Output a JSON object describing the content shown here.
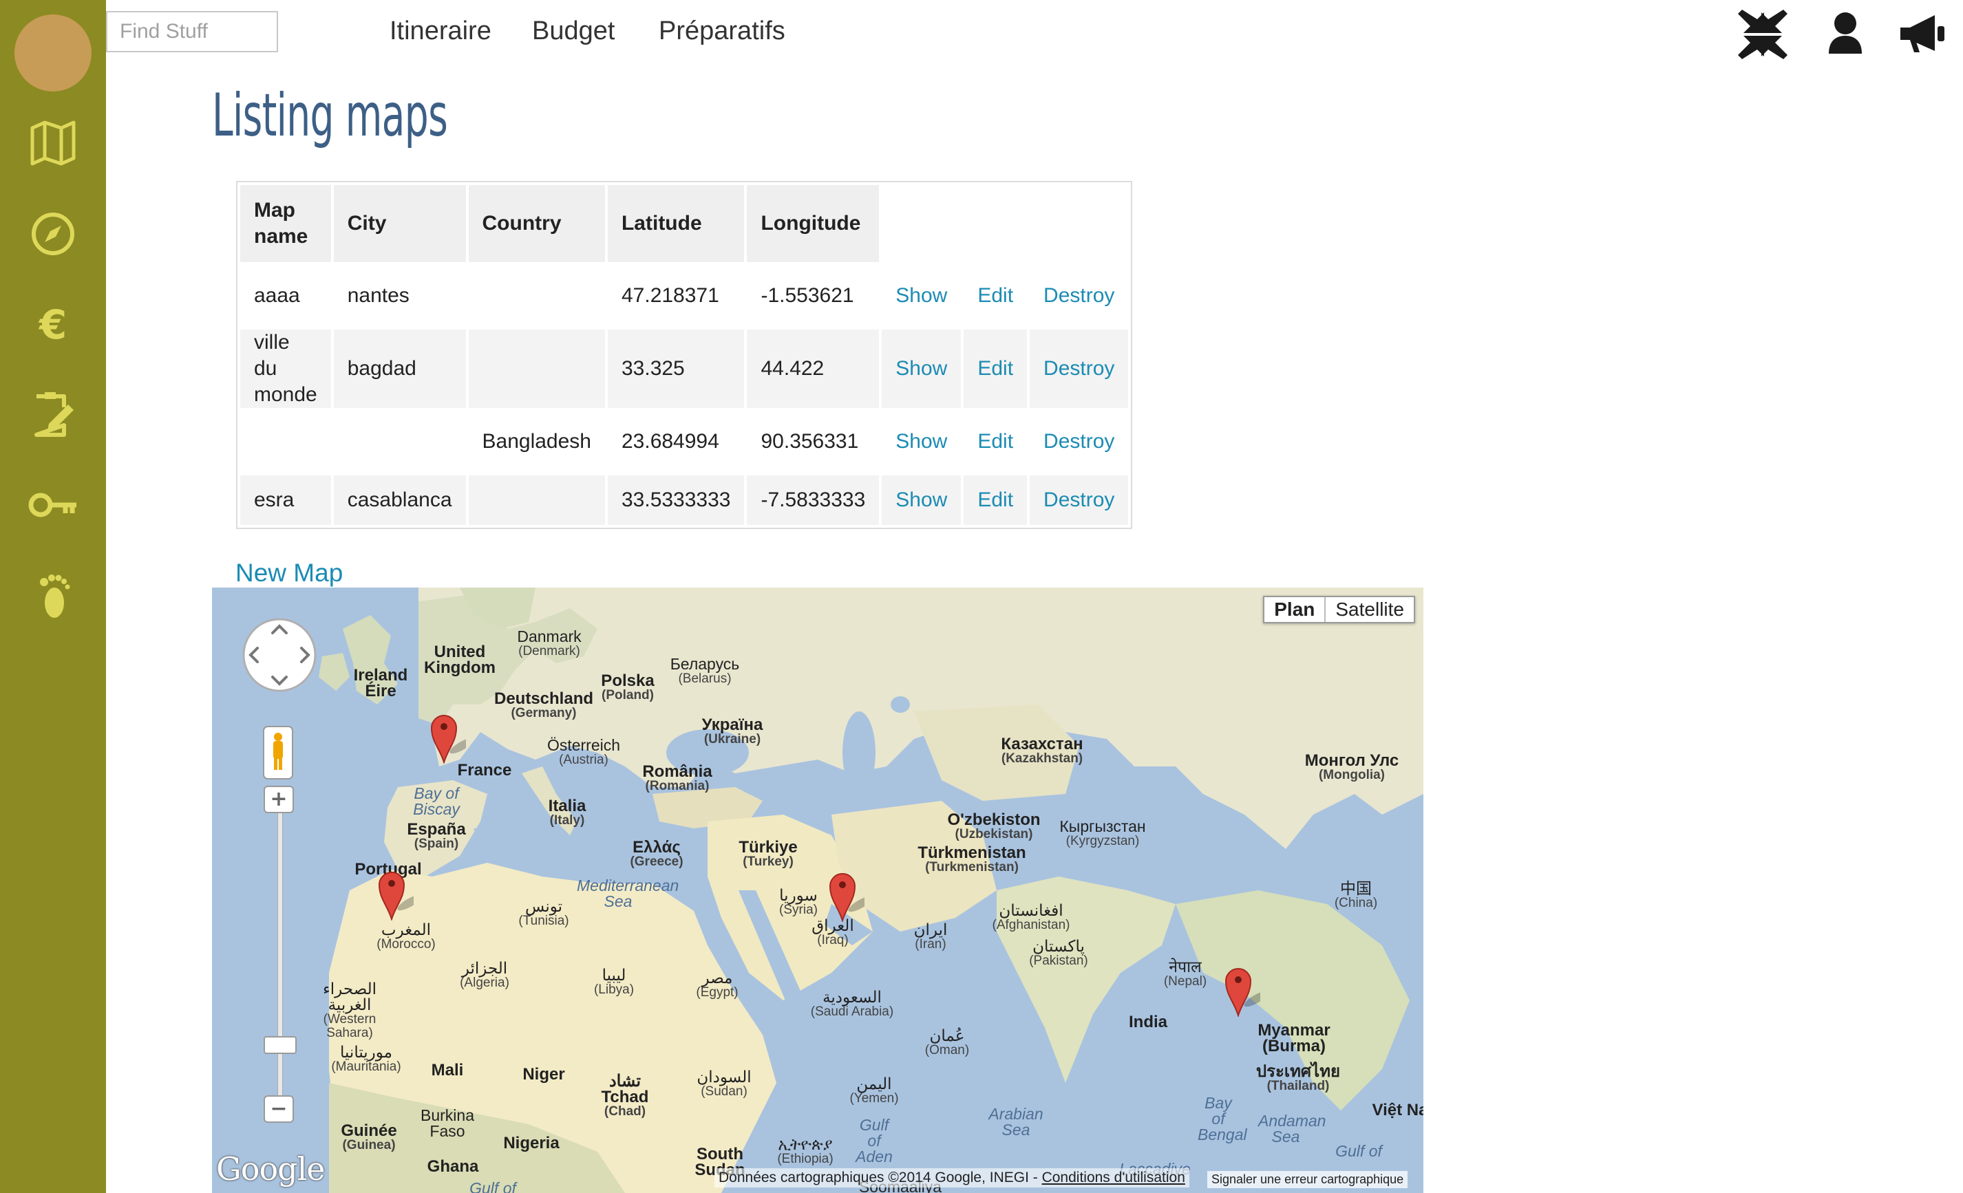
{
  "search": {
    "placeholder": "Find Stuff"
  },
  "nav": {
    "items": [
      "Itineraire",
      "Budget",
      "Préparatifs"
    ]
  },
  "sidebar": {
    "icons": [
      "map-icon",
      "compass-icon",
      "euro-icon",
      "clipboard-edit-icon",
      "key-icon",
      "footprint-icon"
    ]
  },
  "topbar_icons": [
    "compress-icon",
    "user-icon",
    "megaphone-icon"
  ],
  "page": {
    "title": "Listing maps",
    "new_map_label": "New Map"
  },
  "table": {
    "headers": [
      "Map name",
      "City",
      "Country",
      "Latitude",
      "Longitude"
    ],
    "rows": [
      {
        "map_name": "aaaa",
        "city": "nantes",
        "country": "",
        "latitude": "47.218371",
        "longitude": "-1.553621"
      },
      {
        "map_name": "ville du monde",
        "city": "bagdad",
        "country": "",
        "latitude": "33.325",
        "longitude": "44.422"
      },
      {
        "map_name": "",
        "city": "",
        "country": "Bangladesh",
        "latitude": "23.684994",
        "longitude": "90.356331"
      },
      {
        "map_name": "esra",
        "city": "casablanca",
        "country": "",
        "latitude": "33.5333333",
        "longitude": "-7.5833333"
      }
    ],
    "actions": {
      "show": "Show",
      "edit": "Edit",
      "destroy": "Destroy"
    }
  },
  "map": {
    "type_buttons": [
      "Plan",
      "Satellite"
    ],
    "selected_type": "Plan",
    "logo": "Google",
    "attribution_text": "Données cartographiques ©2014 Google, INEGI - ",
    "attribution_link": "Conditions d'utilisation",
    "report_error": "Signaler une erreur cartographique",
    "zoom_in": "+",
    "zoom_out": "−",
    "labels": [
      {
        "name": "Danmark",
        "sub": "(Denmark)"
      },
      {
        "name": "United Kingdom",
        "sub": ""
      },
      {
        "name": "Ireland Éire",
        "sub": ""
      },
      {
        "name": "Беларусь",
        "sub": "(Belarus)"
      },
      {
        "name": "Polska",
        "sub": "(Poland)"
      },
      {
        "name": "Deutschland",
        "sub": "(Germany)"
      },
      {
        "name": "Україна",
        "sub": "(Ukraine)"
      },
      {
        "name": "Österreich",
        "sub": "(Austria)"
      },
      {
        "name": "France",
        "sub": ""
      },
      {
        "name": "România",
        "sub": "(Romania)"
      },
      {
        "name": "Bay of Biscay",
        "sub": ""
      },
      {
        "name": "Italia",
        "sub": "(Italy)"
      },
      {
        "name": "España",
        "sub": "(Spain)"
      },
      {
        "name": "Portugal",
        "sub": ""
      },
      {
        "name": "Ελλάς",
        "sub": "(Greece)"
      },
      {
        "name": "Türkiye",
        "sub": "(Turkey)"
      },
      {
        "name": "Mediterranean Sea",
        "sub": ""
      },
      {
        "name": "تونس",
        "sub": "(Tunisia)"
      },
      {
        "name": "سوريا",
        "sub": "(Syria)"
      },
      {
        "name": "العراق",
        "sub": "(Iraq)"
      },
      {
        "name": "المغرب",
        "sub": "(Morocco)"
      },
      {
        "name": "ایران",
        "sub": "(Iran)"
      },
      {
        "name": "افغانستان",
        "sub": "(Afghanistan)"
      },
      {
        "name": "الجزائر",
        "sub": "(Algeria)"
      },
      {
        "name": "ليبيا",
        "sub": "(Libya)"
      },
      {
        "name": "مصر",
        "sub": "(Egypt)"
      },
      {
        "name": "السعودية",
        "sub": "(Saudi Arabia)"
      },
      {
        "name": "پاکستان",
        "sub": "(Pakistan)"
      },
      {
        "name": "الصحراء الغربية",
        "sub": "(Western Sahara)"
      },
      {
        "name": "عُمان",
        "sub": "(Oman)"
      },
      {
        "name": "موريتانيا",
        "sub": "(Mauritania)"
      },
      {
        "name": "Mali",
        "sub": ""
      },
      {
        "name": "Niger",
        "sub": ""
      },
      {
        "name": "تشاد Tchad",
        "sub": "(Chad)"
      },
      {
        "name": "السودان",
        "sub": "(Sudan)"
      },
      {
        "name": "اليمن",
        "sub": "(Yemen)"
      },
      {
        "name": "Burkina Faso",
        "sub": ""
      },
      {
        "name": "Guinée",
        "sub": "(Guinea)"
      },
      {
        "name": "Nigeria",
        "sub": ""
      },
      {
        "name": "Ghana",
        "sub": ""
      },
      {
        "name": "South Sudan",
        "sub": ""
      },
      {
        "name": "ኢትዮጵያ",
        "sub": "(Ethiopia)"
      },
      {
        "name": "Gulf of Aden",
        "sub": ""
      },
      {
        "name": "Arabian Sea",
        "sub": ""
      },
      {
        "name": "Казахстан",
        "sub": "(Kazakhstan)"
      },
      {
        "name": "Монгол Улс",
        "sub": "(Mongolia)"
      },
      {
        "name": "O'zbekiston",
        "sub": "(Uzbekistan)"
      },
      {
        "name": "Кыргызстан",
        "sub": "(Kyrgyzstan)"
      },
      {
        "name": "Türkmenistan",
        "sub": "(Turkmenistan)"
      },
      {
        "name": "中国",
        "sub": "(China)"
      },
      {
        "name": "नेपाल",
        "sub": "(Nepal)"
      },
      {
        "name": "India",
        "sub": ""
      },
      {
        "name": "Myanmar (Burma)",
        "sub": ""
      },
      {
        "name": "ประเทศไทย",
        "sub": "(Thailand)"
      },
      {
        "name": "Bay of Bengal",
        "sub": ""
      },
      {
        "name": "Andaman Sea",
        "sub": ""
      },
      {
        "name": "Việt Na",
        "sub": ""
      },
      {
        "name": "Gulf of",
        "sub": ""
      },
      {
        "name": "Soomaaliya",
        "sub": ""
      },
      {
        "name": "Laccadive",
        "sub": ""
      },
      {
        "name": "Gulf of",
        "sub": ""
      }
    ]
  },
  "colors": {
    "sidebar": "#8c8a22",
    "sidebar_icon": "#ddd85a",
    "avatar": "#c79c56",
    "title": "#3d5f86",
    "link": "#1b8bb4",
    "marker": "#e0473c"
  }
}
